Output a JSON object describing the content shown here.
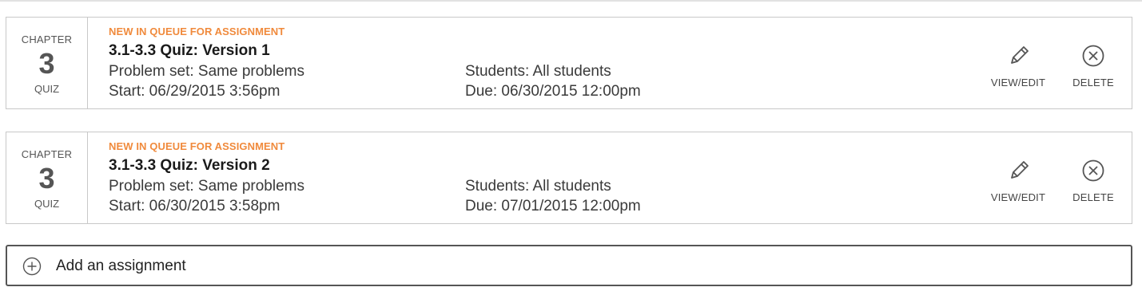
{
  "assignments": [
    {
      "chapter_label": "CHAPTER",
      "chapter_number": "3",
      "chapter_type": "QUIZ",
      "status": "NEW IN QUEUE FOR ASSIGNMENT",
      "title": "3.1-3.3 Quiz: Version 1",
      "problem_set": "Problem set: Same problems",
      "start": "Start: 06/29/2015 3:56pm",
      "students": "Students: All students",
      "due": "Due: 06/30/2015 12:00pm",
      "edit_label": "VIEW/EDIT",
      "delete_label": "DELETE"
    },
    {
      "chapter_label": "CHAPTER",
      "chapter_number": "3",
      "chapter_type": "QUIZ",
      "status": "NEW IN QUEUE FOR ASSIGNMENT",
      "title": "3.1-3.3 Quiz: Version 2",
      "problem_set": "Problem set: Same problems",
      "start": "Start: 06/30/2015 3:58pm",
      "students": "Students: All students",
      "due": "Due: 07/01/2015 12:00pm",
      "edit_label": "VIEW/EDIT",
      "delete_label": "DELETE"
    }
  ],
  "add_assignment": {
    "label": "Add an assignment",
    "icon": "plus-circle-icon"
  },
  "icons": {
    "edit": "pencil-icon",
    "delete": "close-circle-icon"
  },
  "colors": {
    "status_accent": "#f08a3c",
    "border": "#c8c8c8",
    "icon": "#555555"
  }
}
